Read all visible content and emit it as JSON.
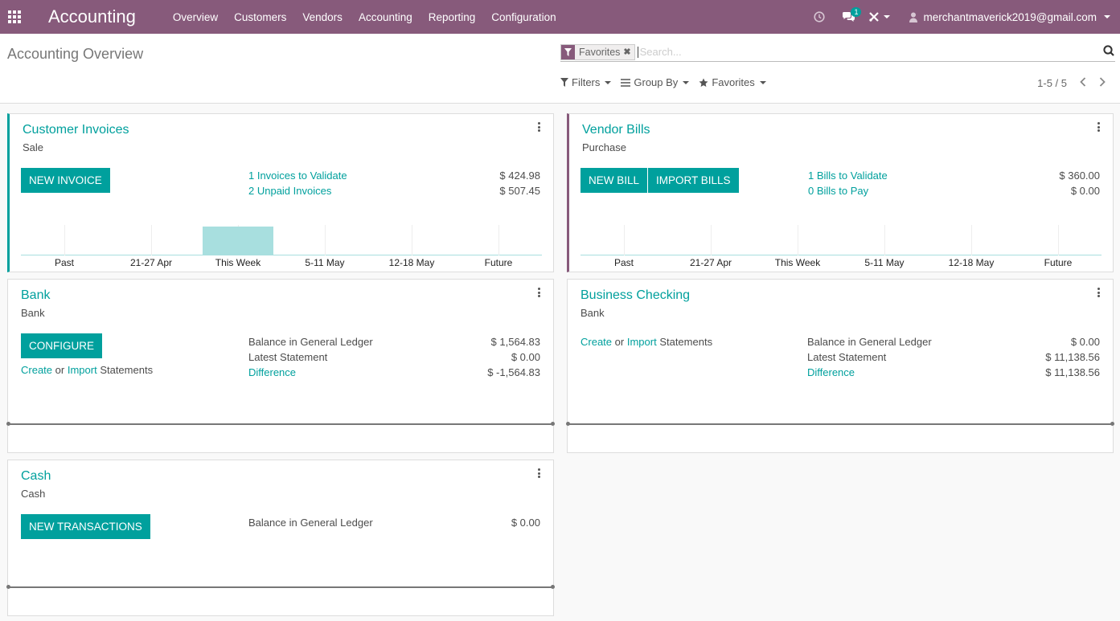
{
  "navbar": {
    "brand": "Accounting",
    "menu": [
      "Overview",
      "Customers",
      "Vendors",
      "Accounting",
      "Reporting",
      "Configuration"
    ],
    "chat_badge": "1",
    "user": "merchantmaverick2019@gmail.com",
    "color": "#875a7b"
  },
  "control": {
    "title": "Accounting Overview",
    "facet": "Favorites",
    "search_placeholder": "Search...",
    "filters": "Filters",
    "group_by": "Group By",
    "favorites": "Favorites",
    "pager": "1-5 / 5"
  },
  "cards": {
    "customer_invoices": {
      "title": "Customer Invoices",
      "subtitle": "Sale",
      "button": "NEW INVOICE",
      "stats": [
        {
          "label": "1 Invoices to Validate",
          "value": "$ 424.98"
        },
        {
          "label": "2 Unpaid Invoices",
          "value": "$ 507.45"
        }
      ],
      "graph_labels": [
        "Past",
        "21-27 Apr",
        "This Week",
        "5-11 May",
        "12-18 May",
        "Future"
      ],
      "graph_values": [
        0,
        0,
        1,
        0,
        0,
        0
      ]
    },
    "vendor_bills": {
      "title": "Vendor Bills",
      "subtitle": "Purchase",
      "button1": "NEW BILL",
      "button2": "IMPORT BILLS",
      "stats": [
        {
          "label": "1 Bills to Validate",
          "value": "$ 360.00"
        },
        {
          "label": "0 Bills to Pay",
          "value": "$ 0.00"
        }
      ],
      "graph_labels": [
        "Past",
        "21-27 Apr",
        "This Week",
        "5-11 May",
        "12-18 May",
        "Future"
      ],
      "graph_values": [
        0,
        0,
        0,
        0,
        0,
        0
      ]
    },
    "bank": {
      "title": "Bank",
      "subtitle": "Bank",
      "button": "CONFIGURE",
      "create": "Create",
      "or": "or",
      "import": "Import",
      "statements": "Statements",
      "stats": [
        {
          "label": "Balance in General Ledger",
          "value": "$ 1,564.83"
        },
        {
          "label": "Latest Statement",
          "value": "$ 0.00"
        },
        {
          "label": "Difference",
          "value": "$ -1,564.83"
        }
      ]
    },
    "business_checking": {
      "title": "Business Checking",
      "subtitle": "Bank",
      "create": "Create",
      "or": "or",
      "import": "Import",
      "statements": "Statements",
      "stats": [
        {
          "label": "Balance in General Ledger",
          "value": "$ 0.00"
        },
        {
          "label": "Latest Statement",
          "value": "$ 11,138.56"
        },
        {
          "label": "Difference",
          "value": "$ 11,138.56"
        }
      ]
    },
    "cash": {
      "title": "Cash",
      "subtitle": "Cash",
      "button": "NEW TRANSACTIONS",
      "stats": [
        {
          "label": "Balance in General Ledger",
          "value": "$ 0.00"
        }
      ]
    }
  }
}
